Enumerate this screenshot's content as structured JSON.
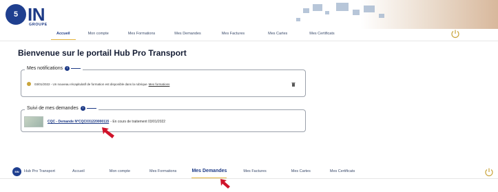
{
  "logo": {
    "circle_text": "5",
    "word": "IN",
    "sub": "GROUPE"
  },
  "nav_top": [
    {
      "label": "Accueil",
      "active": true
    },
    {
      "label": "Mon compte",
      "active": false
    },
    {
      "label": "Mes Formations",
      "active": false
    },
    {
      "label": "Mes Demandes",
      "active": false
    },
    {
      "label": "Mes Factures",
      "active": false
    },
    {
      "label": "Mes Cartes",
      "active": false
    },
    {
      "label": "Mes Certificats",
      "active": false
    }
  ],
  "page_title": "Bienvenue sur le portail Hub Pro Transport",
  "notifications": {
    "legend": "Mes notifications",
    "badge": "i",
    "text": "03/01/2022 - Un nouveau récapitulatif de formation est disponible dans la rubrique",
    "link": "Mes formations"
  },
  "demandes": {
    "legend": "Suivi de mes demandes",
    "badge": "i",
    "link": "CQC - Demande N°CQC031220000115",
    "status": "- En cours de traitement 03/01/2022"
  },
  "bottom_nav": {
    "logo_text": "5IN",
    "brand": "Hub Pro Transport",
    "items": [
      {
        "label": "Accueil",
        "active": false
      },
      {
        "label": "Mon compte",
        "active": false
      },
      {
        "label": "Mes Formations",
        "active": false
      },
      {
        "label": "Mes Demandes",
        "active": true
      },
      {
        "label": "Mes Factures",
        "active": false
      },
      {
        "label": "Mes Cartes",
        "active": false
      },
      {
        "label": "Mes Certificats",
        "active": false
      }
    ]
  },
  "colors": {
    "brand": "#1d3a86",
    "accent": "#e2b23a",
    "arrow": "#d0132a"
  },
  "icons": [
    "power-icon",
    "trash-icon",
    "info-icon",
    "arrow-pointer-icon"
  ]
}
